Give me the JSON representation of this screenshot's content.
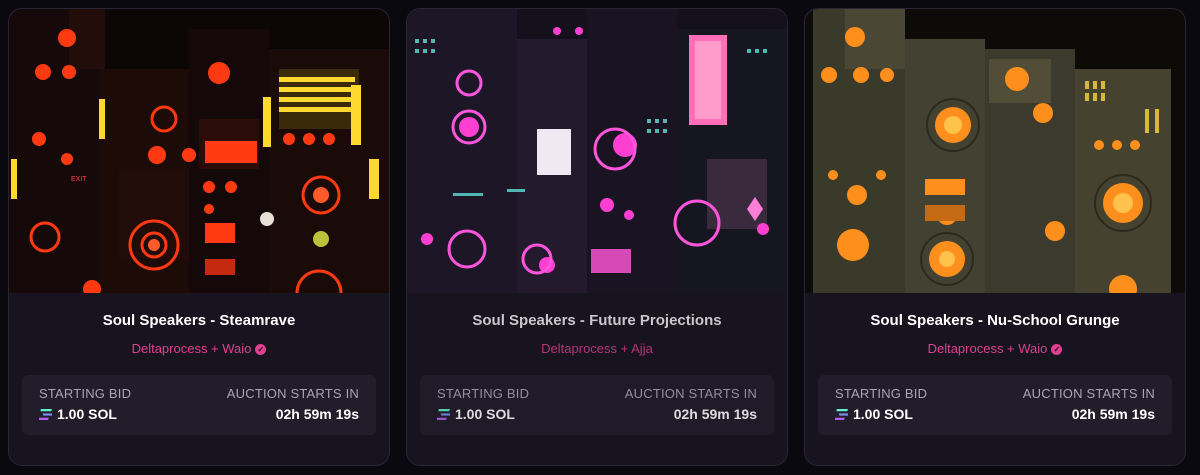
{
  "cards": [
    {
      "title": "Soul Speakers - Steamrave",
      "artist": "Deltaprocess + Waio",
      "bid_label": "STARTING BID",
      "bid_value": "1.00 SOL",
      "auction_label": "AUCTION STARTS IN",
      "auction_value": "02h 59m 19s",
      "accent": "#ff4a1c"
    },
    {
      "title": "Soul Speakers - Future Projections",
      "artist": "Deltaprocess + Ajja",
      "bid_label": "STARTING BID",
      "bid_value": "1.00 SOL",
      "auction_label": "AUCTION STARTS IN",
      "auction_value": "02h 59m 19s",
      "accent": "#ff3fd2"
    },
    {
      "title": "Soul Speakers - Nu-School Grunge",
      "artist": "Deltaprocess + Waio",
      "bid_label": "STARTING BID",
      "bid_value": "1.00 SOL",
      "auction_label": "AUCTION STARTS IN",
      "auction_value": "02h 59m 19s",
      "accent": "#ff8a1c"
    }
  ],
  "icons": {
    "verified": "verified-badge-icon",
    "currency": "solana-icon"
  },
  "colors": {
    "artist": "#e0408f",
    "background": "#0b0910",
    "card": "#17131f",
    "panel": "#221d2b"
  }
}
